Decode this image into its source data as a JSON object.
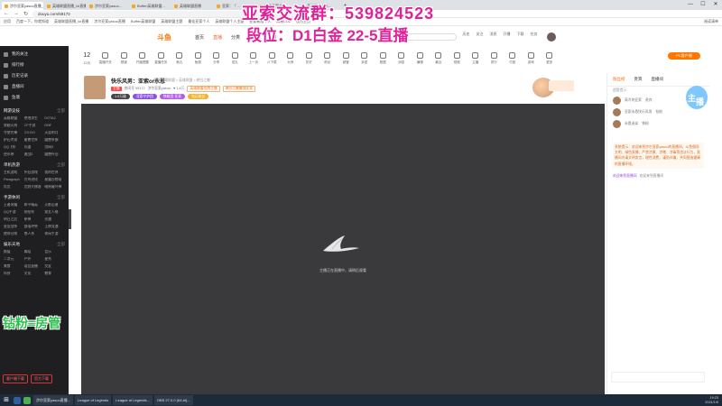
{
  "browser": {
    "tabs": [
      "涉尔亚索yasuo直播_英雄联盟...",
      "英雄联盟直播_lol直播...",
      "涉尔亚索yasuo...",
      "Bufferi英雄联盟...",
      "英雄联盟直播",
      "亚索：「 ...",
      "最佳亚索个人...",
      "英雄联盟个人..."
    ],
    "url": "douyu.com/59172",
    "bookmarks": [
      "应用",
      "百度一下，你就知道",
      "英雄联盟直播_lol直播",
      "涉尔亚索yasuo直播",
      "Bufferi英雄联盟",
      "英雄联盟主题",
      "最佳亚索个人",
      "英雄联盟个人主题",
      "亚索新版个人",
      "网易LOL",
      "设为主页"
    ],
    "bookmarks_right": "阅读清单",
    "window_controls": [
      "—",
      "☐",
      "✕"
    ]
  },
  "overlay": {
    "line1": "亚索交流群：539824523",
    "line2": "段位：D1白金 22-5直播",
    "side_text": "钻粉=房管"
  },
  "site": {
    "logo": "斗鱼",
    "nav": [
      "首页",
      "直播",
      "分类",
      "游戏",
      "鱼吧"
    ],
    "nav_active": 1,
    "search_placeholder": "搜索",
    "header_icons": [
      "历史",
      "关注",
      "消息",
      "开播",
      "下载",
      "任务"
    ]
  },
  "sidebar": {
    "top_items": [
      "我的关注",
      "排行榜",
      "历史记录",
      "直播间",
      "鱼塘"
    ],
    "sections": [
      {
        "title": "网游竞技",
        "more": "全部",
        "items": [
          "英雄联盟",
          "绝地求生",
          "DOTA2",
          "穿越火线",
          "CF手游",
          "DNF",
          "守望先锋",
          "CS:GO",
          "天涯明月",
          "炉石传说",
          "魔兽世界",
          "魔兽争霸",
          "QQ飞车",
          "问道",
          "剑网3",
          "逆水寒",
          "激战2",
          "魔兽怀旧"
        ]
      },
      {
        "title": "单机热游",
        "more": "全部",
        "items": [
          "主机游戏",
          "怀旧游戏",
          "我的世界",
          "Paragraph",
          "方舟进化",
          "星露谷物语",
          "饥荒",
          "荒野大镖客",
          "暗黑破坏神"
        ]
      },
      {
        "title": "手游休闲",
        "more": "全部",
        "items": [
          "王者荣耀",
          "和平精英",
          "火影忍者",
          "QQ手游",
          "阴阳师",
          "第五人格",
          "明日之后",
          "原神",
          "光遇",
          "皇室战争",
          "部落冲突",
          "王牌竞速",
          "使命召唤",
          "狼人杀",
          "休闲手游"
        ]
      },
      {
        "title": "娱乐天地",
        "more": "全部",
        "items": [
          "颜值",
          "舞蹈",
          "音乐",
          "二次元",
          "户外",
          "星秀",
          "美食",
          "语音直播",
          "交友",
          "科技",
          "文化",
          "教育"
        ]
      }
    ],
    "bottom_buttons": [
      "客户端下载",
      "官方下载"
    ]
  },
  "categories": [
    "12月",
    "直播开关",
    "频道",
    "开播提醒",
    "直播任务",
    "鱼丸",
    "鱼翅",
    "分享",
    "送礼",
    "上一页",
    "六下载",
    "大师",
    "历史",
    "粉丝",
    "超管",
    "亲密",
    "数据",
    "消息",
    "编辑",
    "最近",
    "视频",
    "主播",
    "排行",
    "付费",
    "游戏",
    "更多"
  ],
  "categories_first": "12",
  "pc_button": "PC客户端",
  "streamer": {
    "title": "快乐风男：亚索or永恩",
    "tag": "举报  英雄联盟 > 英雄联盟 > 峡谷之巅",
    "row2": [
      "房间号 59172",
      "涉尔亚索yasuo",
      "♥ 1.4万"
    ],
    "badge": "主播",
    "orange_tags": [
      "英雄联盟金牌主播",
      "峡谷之巅最强亚索"
    ],
    "pills": [
      "1.0万级",
      "亚索守护团",
      "铁粉团·亚索",
      "钻石粉丝"
    ],
    "follow": "关注",
    "report": "举报",
    "small_stats": [
      "分享",
      "客户端",
      "更多"
    ]
  },
  "player": {
    "loading_text": "主播正在直播中，请稍后观看"
  },
  "chat": {
    "tabs": [
      "粉丝榜",
      "贵宾",
      "直播间"
    ],
    "active_tab": 0,
    "header_note": "超管提示",
    "rank_rows": [
      {
        "name": "高冷的亚索",
        "tag": "贵宾"
      },
      {
        "name": "亚索永恩快乐风男",
        "tag": "钻粉"
      },
      {
        "name": "永恩迷弟",
        "tag": "铁粉"
      }
    ],
    "notice": "系统提示：欢迎来到涉尔亚索yasuo的直播间，斗鱼倡导文明、绿色直播，严禁涉黄、涉赌、涉毒等违法行为，直播间内请文明发言，理性消费，谨防诈骗，共同营造健康的直播环境。",
    "sysmsg_user": "欢迎来到直播间",
    "sysmsg_text": "欢迎来到直播间"
  },
  "taskbar": {
    "apps": [
      "涉尔亚索yasuo直播...",
      "League of Legends",
      "League of Legends...",
      "OBS 27.0.0 (64-bi)..."
    ],
    "time": "19:23",
    "date": "2021/1/9"
  },
  "colors": {
    "accent": "#ff7700",
    "overlay_pink": "#e0229a",
    "overlay_green": "#2bc04b",
    "sidebar_bg": "#1f1f22"
  }
}
